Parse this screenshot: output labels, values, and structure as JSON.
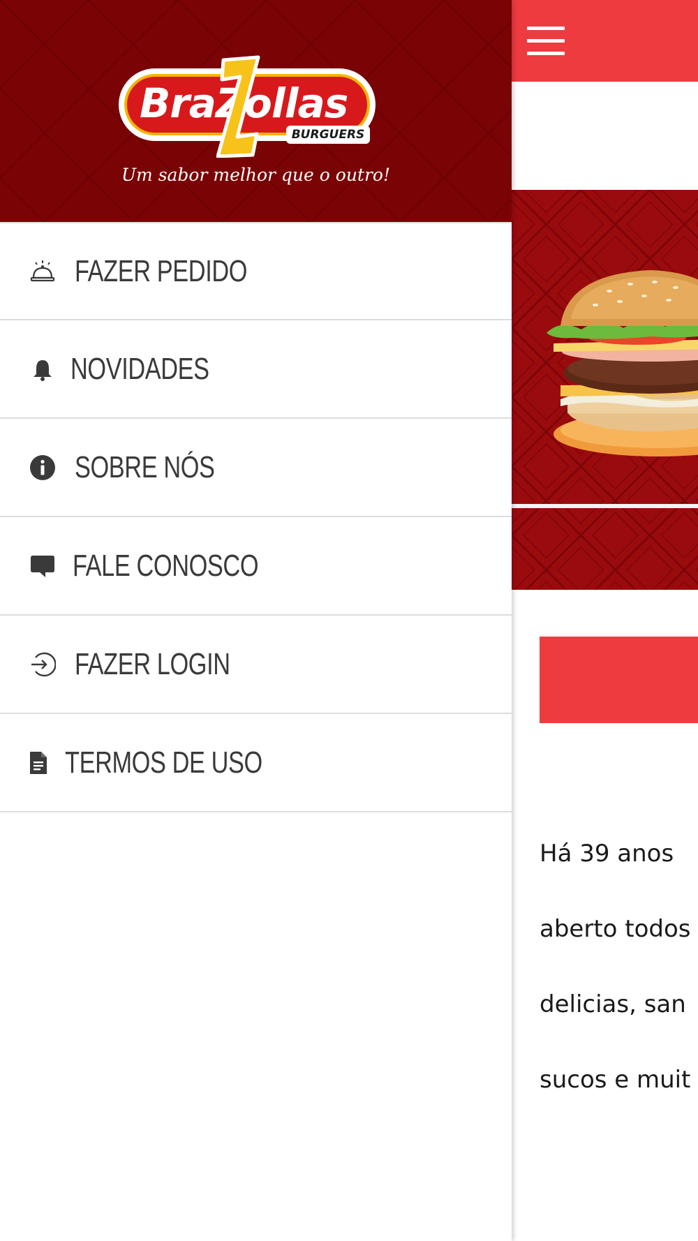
{
  "app": {
    "brand_name": "BraZollas",
    "brand_sub": "BURGUERS",
    "tagline": "Um sabor melhor que o outro!"
  },
  "drawer": {
    "items": [
      {
        "label": "FAZER PEDIDO",
        "icon": "service-bell-icon"
      },
      {
        "label": "NOVIDADES",
        "icon": "bell-icon"
      },
      {
        "label": "SOBRE NÓS",
        "icon": "info-icon"
      },
      {
        "label": "FALE CONOSCO",
        "icon": "chat-bubble-icon"
      },
      {
        "label": "FAZER LOGIN",
        "icon": "login-icon"
      },
      {
        "label": "TERMOS DE USO",
        "icon": "document-icon"
      }
    ]
  },
  "main": {
    "menu_icon": "hamburger-menu-icon",
    "banner_image": "burger-with-fries-photo",
    "about_text_lines": [
      "Há 39 anos ",
      "aberto todos",
      "delicias, san",
      "sucos e muit"
    ]
  },
  "colors": {
    "drawer_header": "#7a0305",
    "topbar": "#ee3b3f",
    "banner": "#9a0b0e",
    "menu_text": "#3a3a3a",
    "divider": "#dcdcdc"
  }
}
